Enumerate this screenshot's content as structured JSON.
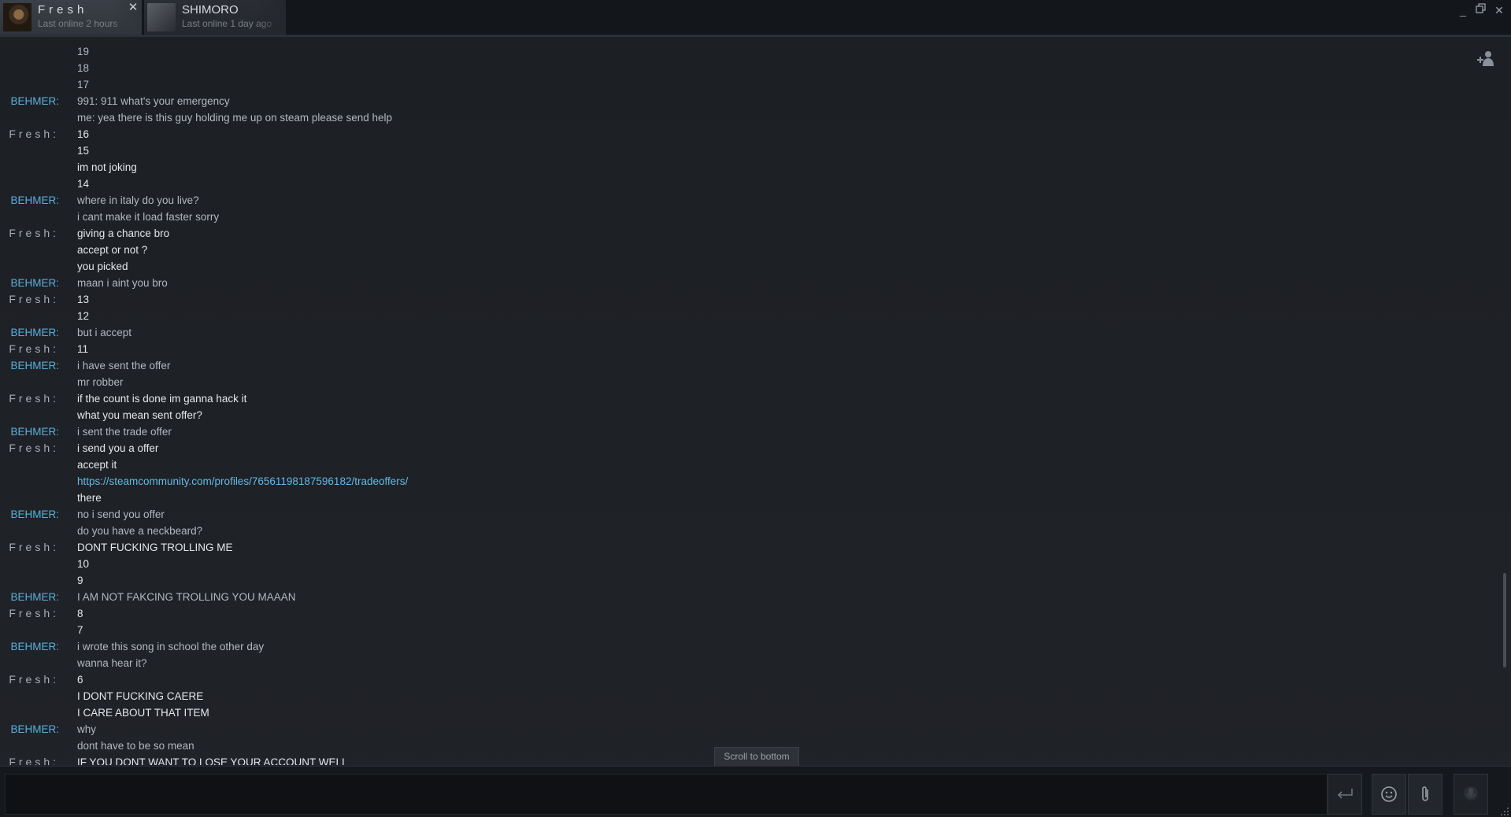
{
  "tabs": [
    {
      "name": "Fresh",
      "status": "Last online 2 hours",
      "active": true
    },
    {
      "name": "SHIMORO",
      "status": "Last online 1 day ago",
      "active": false
    }
  ],
  "window": {
    "minimize_icon": "minimize-icon",
    "maximize_icon": "restore-icon",
    "close_icon": "close-icon"
  },
  "messages": [
    {
      "sender": "",
      "text": "19"
    },
    {
      "sender": "",
      "text": "18"
    },
    {
      "sender": "",
      "text": "17"
    },
    {
      "sender": "BEHMER:",
      "text": "991: 911 what's your emergency"
    },
    {
      "sender": "",
      "text": "me: yea there is this guy holding me up on steam please send help"
    },
    {
      "sender": "Fresh:",
      "text": "16"
    },
    {
      "sender": "",
      "text": "15"
    },
    {
      "sender": "",
      "text": "im not joking"
    },
    {
      "sender": "",
      "text": "14"
    },
    {
      "sender": "BEHMER:",
      "text": "where in italy do you live?"
    },
    {
      "sender": "",
      "text": "i cant make it load faster sorry"
    },
    {
      "sender": "Fresh:",
      "text": "giving a chance bro"
    },
    {
      "sender": "",
      "text": "accept or not ?"
    },
    {
      "sender": "",
      "text": "you picked"
    },
    {
      "sender": "BEHMER:",
      "text": "maan i aint you bro"
    },
    {
      "sender": "Fresh:",
      "text": "13"
    },
    {
      "sender": "",
      "text": "12"
    },
    {
      "sender": "BEHMER:",
      "text": "but i accept"
    },
    {
      "sender": "Fresh:",
      "text": "11"
    },
    {
      "sender": "BEHMER:",
      "text": "i have sent the offer"
    },
    {
      "sender": "",
      "text": "mr robber"
    },
    {
      "sender": "Fresh:",
      "text": "if the count is done im ganna hack it"
    },
    {
      "sender": "",
      "text": "what you mean sent offer?"
    },
    {
      "sender": "BEHMER:",
      "text": "i sent the trade offer"
    },
    {
      "sender": "Fresh:",
      "text": "i send you a offer"
    },
    {
      "sender": "",
      "text": "accept it"
    },
    {
      "sender": "",
      "text": "https://steamcommunity.com/profiles/76561198187596182/tradeoffers/",
      "link": true
    },
    {
      "sender": "",
      "text": "there"
    },
    {
      "sender": "BEHMER:",
      "text": "no i send you offer"
    },
    {
      "sender": "",
      "text": "do you have a neckbeard?"
    },
    {
      "sender": "Fresh:",
      "text": "DONT FUCKING TROLLING ME"
    },
    {
      "sender": "",
      "text": "10"
    },
    {
      "sender": "",
      "text": "9"
    },
    {
      "sender": "BEHMER:",
      "text": "I AM NOT FAKCING TROLLING YOU MAAAN"
    },
    {
      "sender": "Fresh:",
      "text": "8"
    },
    {
      "sender": "",
      "text": "7"
    },
    {
      "sender": "BEHMER:",
      "text": "i wrote this song in school the other day"
    },
    {
      "sender": "",
      "text": "wanna hear it?"
    },
    {
      "sender": "Fresh:",
      "text": "6"
    },
    {
      "sender": "",
      "text": "I DONT FUCKING CAERE"
    },
    {
      "sender": "",
      "text": "I CARE ABOUT THAT ITEM"
    },
    {
      "sender": "BEHMER:",
      "text": "why"
    },
    {
      "sender": "",
      "text": "dont have to be so mean"
    },
    {
      "sender": "Fresh:",
      "text": "IF YOU DONT WANT TO LOSE YOUR ACCOUNT WELL"
    }
  ],
  "scroll_to_bottom_label": "Scroll to bottom",
  "input": {
    "value": "",
    "placeholder": ""
  },
  "colors": {
    "behmer": "#5ab0dc",
    "fresh_name": "#a8aeb6",
    "link": "#62b9e6",
    "background": "#1e2126"
  }
}
